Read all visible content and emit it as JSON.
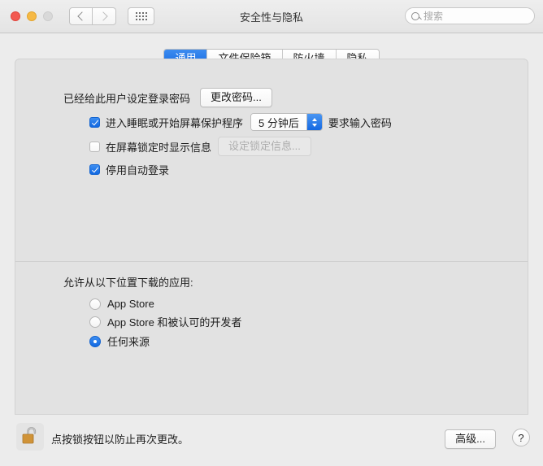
{
  "window": {
    "title": "安全性与隐私",
    "traffic_lights": [
      "close-button",
      "minimize-button",
      "zoom-button-disabled"
    ],
    "nav": {
      "back": "back-icon",
      "forward": "forward-icon",
      "show_all": "grid-icon"
    },
    "search": {
      "placeholder": "搜索",
      "value": "",
      "icon": "search-icon"
    }
  },
  "tabs": [
    {
      "label": "通用",
      "active": true
    },
    {
      "label": "文件保险箱",
      "active": false
    },
    {
      "label": "防火墙",
      "active": false
    },
    {
      "label": "隐私",
      "active": false
    }
  ],
  "general": {
    "password_status": "已经给此用户设定登录密码",
    "change_password_button": "更改密码...",
    "checkboxes": [
      {
        "label": "进入睡眠或开始屏幕保护程序",
        "checked": true,
        "combo_value": "5 分钟后",
        "suffix_label": "要求输入密码"
      },
      {
        "label": "在屏幕锁定时显示信息",
        "checked": false,
        "button_label": "设定锁定信息...",
        "button_disabled": true
      },
      {
        "label": "停用自动登录",
        "checked": true
      }
    ]
  },
  "downloads": {
    "section_title": "允许从以下位置下载的应用:",
    "options": [
      {
        "label": "App Store",
        "selected": false
      },
      {
        "label": "App Store 和被认可的开发者",
        "selected": false
      },
      {
        "label": "任何来源",
        "selected": true
      }
    ]
  },
  "footer": {
    "lock_icon": "unlocked-padlock-icon",
    "lock_message": "点按锁按钮以防止再次更改。",
    "advanced_button": "高级...",
    "help_button": "?"
  },
  "colors": {
    "accent": "#1268e1",
    "window_bg": "#ececec",
    "panel_bg": "#e2e2e2",
    "lock_gold": "#d89a3c"
  }
}
